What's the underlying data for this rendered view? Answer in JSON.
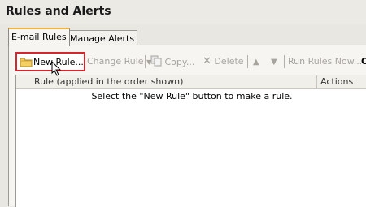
{
  "window": {
    "title": "Rules and Alerts"
  },
  "tabs": [
    {
      "label": "E-mail Rules",
      "active": true
    },
    {
      "label": "Manage Alerts",
      "active": false
    }
  ],
  "toolbar": {
    "new_rule": "New Rule...",
    "change_rule": "Change Rule",
    "copy": "Copy...",
    "delete": "Delete",
    "run_rules_now": "Run Rules Now...",
    "overflow": "O"
  },
  "rules_list": {
    "columns": [
      "Rule (applied in the order shown)",
      "Actions"
    ],
    "empty_message": "Select the \"New Rule\" button to make a rule."
  },
  "colors": {
    "highlight_border": "#d5262d",
    "tab_accent": "#f2b33d",
    "disabled_text": "#a7a49d"
  },
  "icons": [
    "folder-new-icon",
    "chevron-down-icon",
    "copy-icon",
    "delete-x-icon",
    "arrow-up-icon",
    "arrow-down-icon",
    "mouse-cursor-icon"
  ]
}
